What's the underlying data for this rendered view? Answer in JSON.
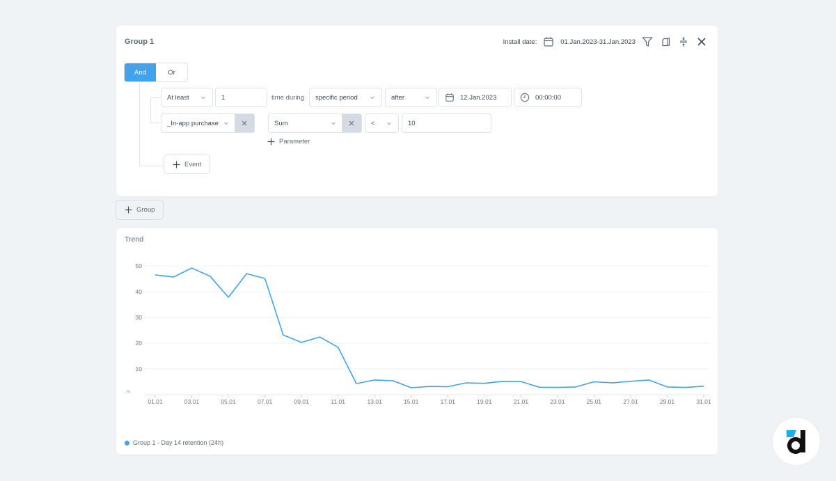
{
  "group": {
    "title": "Group 1",
    "install_date_label": "Install date:",
    "install_date_value": "01.Jan.2023-31.Jan.2023",
    "icons": [
      "calendar-icon",
      "filter-icon",
      "copy-icon",
      "collapse-icon",
      "close-icon"
    ],
    "logic": {
      "and_label": "And",
      "or_label": "Or",
      "active": "And"
    },
    "condition_row": {
      "quantifier": "At least",
      "count": "1",
      "time_during_label": "time during",
      "period_type": "specific period",
      "relation": "after",
      "date": "12.Jan.2023",
      "time": "00:00:00"
    },
    "event_row": {
      "event": "_In-app purchase",
      "param_aggregate": "Sum",
      "operator": "<",
      "value": "10",
      "add_parameter_label": "Parameter"
    },
    "add_event_label": "Event"
  },
  "add_group_label": "Group",
  "trend": {
    "title": "Trend",
    "legend": "Group 1 - Day 14 retention (24h)",
    "line_color": "#42a2ea"
  },
  "chart_data": {
    "type": "line",
    "title": "Trend",
    "xlabel": "",
    "ylabel": "%",
    "ylim": [
      0,
      50
    ],
    "yticks": [
      10,
      20,
      30,
      40,
      50
    ],
    "grid": true,
    "legend_position": "bottom-left",
    "x": [
      "01.01",
      "02.01",
      "03.01",
      "04.01",
      "05.01",
      "06.01",
      "07.01",
      "08.01",
      "09.01",
      "10.01",
      "11.01",
      "12.01",
      "13.01",
      "14.01",
      "15.01",
      "16.01",
      "17.01",
      "18.01",
      "19.01",
      "20.01",
      "21.01",
      "22.01",
      "23.01",
      "24.01",
      "25.01",
      "26.01",
      "27.01",
      "28.01",
      "29.01",
      "30.01",
      "31.01"
    ],
    "xtick_labels": [
      "01.01",
      "03.01",
      "05.01",
      "07.01",
      "09.01",
      "11.01",
      "13.01",
      "15.01",
      "17.01",
      "19.01",
      "21.01",
      "23.01",
      "25.01",
      "27.01",
      "29.01",
      "31.01"
    ],
    "series": [
      {
        "name": "Group 1 - Day 14 retention (24h)",
        "values": [
          46.5,
          45.7,
          49.2,
          46.0,
          37.8,
          47.0,
          45.1,
          23.2,
          20.3,
          22.4,
          18.4,
          4.3,
          5.7,
          5.4,
          2.7,
          3.2,
          3.1,
          4.6,
          4.4,
          5.2,
          5.1,
          2.9,
          2.8,
          3.0,
          5.0,
          4.6,
          5.2,
          5.7,
          3.0,
          2.8,
          3.3
        ]
      }
    ]
  }
}
